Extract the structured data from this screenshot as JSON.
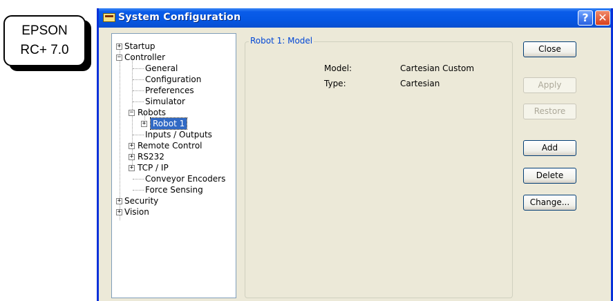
{
  "badge": {
    "line1": "EPSON",
    "line2": "RC+ 7.0"
  },
  "window": {
    "title": "System Configuration",
    "help_label": "?",
    "close_label": "✕"
  },
  "tree": {
    "items": [
      {
        "label": "Startup",
        "expander": "+"
      },
      {
        "label": "Controller",
        "expander": "−"
      },
      {
        "label": "General"
      },
      {
        "label": "Configuration"
      },
      {
        "label": "Preferences"
      },
      {
        "label": "Simulator"
      },
      {
        "label": "Robots",
        "expander": "−"
      },
      {
        "label": "Robot 1",
        "expander": "+",
        "selected": true
      },
      {
        "label": "Inputs / Outputs"
      },
      {
        "label": "Remote Control",
        "expander": "+"
      },
      {
        "label": "RS232",
        "expander": "+"
      },
      {
        "label": "TCP / IP",
        "expander": "+"
      },
      {
        "label": "Conveyor Encoders"
      },
      {
        "label": "Force Sensing"
      },
      {
        "label": "Security",
        "expander": "+"
      },
      {
        "label": "Vision",
        "expander": "+"
      }
    ]
  },
  "panel": {
    "legend": "Robot 1: Model",
    "fields": [
      {
        "label": "Model:",
        "value": "Cartesian Custom"
      },
      {
        "label": "Type:",
        "value": "Cartesian"
      }
    ]
  },
  "buttons": {
    "close": "Close",
    "apply": "Apply",
    "restore": "Restore",
    "add": "Add",
    "delete": "Delete",
    "change": "Change..."
  }
}
